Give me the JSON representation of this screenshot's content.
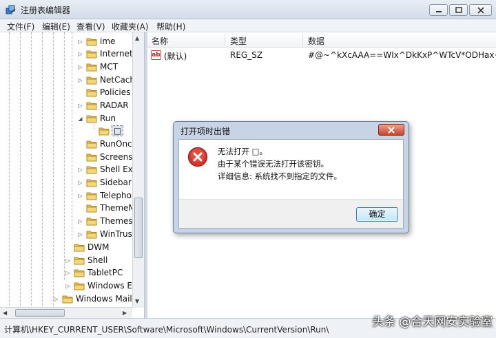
{
  "window": {
    "title": "注册表编辑器",
    "menu": [
      "文件(F)",
      "编辑(E)",
      "查看(V)",
      "收藏夹(A)",
      "帮助(H)"
    ]
  },
  "tree": {
    "items": [
      {
        "label": "ime",
        "expander": "▷"
      },
      {
        "label": "Internet",
        "expander": "▷"
      },
      {
        "label": "MCT",
        "expander": "▷"
      },
      {
        "label": "NetCach",
        "expander": "▷"
      },
      {
        "label": "Policies",
        "expander": ""
      },
      {
        "label": "RADAR",
        "expander": "▷"
      },
      {
        "label": "Run",
        "expander": "◢"
      },
      {
        "label": "□",
        "expander": "",
        "selected": true
      },
      {
        "label": "RunOnce",
        "expander": ""
      },
      {
        "label": "Screensa",
        "expander": ""
      },
      {
        "label": "Shell Exte",
        "expander": "▷"
      },
      {
        "label": "Sidebar",
        "expander": "▷"
      },
      {
        "label": "Telephor",
        "expander": "▷"
      },
      {
        "label": "ThemeM",
        "expander": ""
      },
      {
        "label": "Themes",
        "expander": "▷"
      },
      {
        "label": "WinTrust",
        "expander": "▷"
      },
      {
        "label": "DWM",
        "expander": ""
      },
      {
        "label": "Shell",
        "expander": "▷"
      },
      {
        "label": "TabletPC",
        "expander": "▷"
      },
      {
        "label": "Windows Er",
        "expander": "▷"
      },
      {
        "label": "Windows Mail",
        "expander": "▷"
      }
    ]
  },
  "list": {
    "columns": [
      "名称",
      "类型",
      "数据"
    ],
    "rows": [
      {
        "name": "(默认)",
        "type": "REG_SZ",
        "data": "#@~^kXcAAA==WIx^DkKxP^WTcV*ODHax+…"
      }
    ],
    "icon_text": "ab"
  },
  "status": {
    "path": "计算机\\HKEY_CURRENT_USER\\Software\\Microsoft\\Windows\\CurrentVersion\\Run\\"
  },
  "watermark": "头条 @合天网安实验室",
  "dialog": {
    "title": "打开项时出错",
    "line1": "无法打开 □。",
    "line2": "由于某个错误无法打开该密钥。",
    "line3": "详细信息: 系统找不到指定的文件。",
    "ok_label": "确定"
  },
  "colors": {
    "error_red": "#d9342b",
    "close_red": "#c9452c",
    "selection": "#dde7f3"
  }
}
